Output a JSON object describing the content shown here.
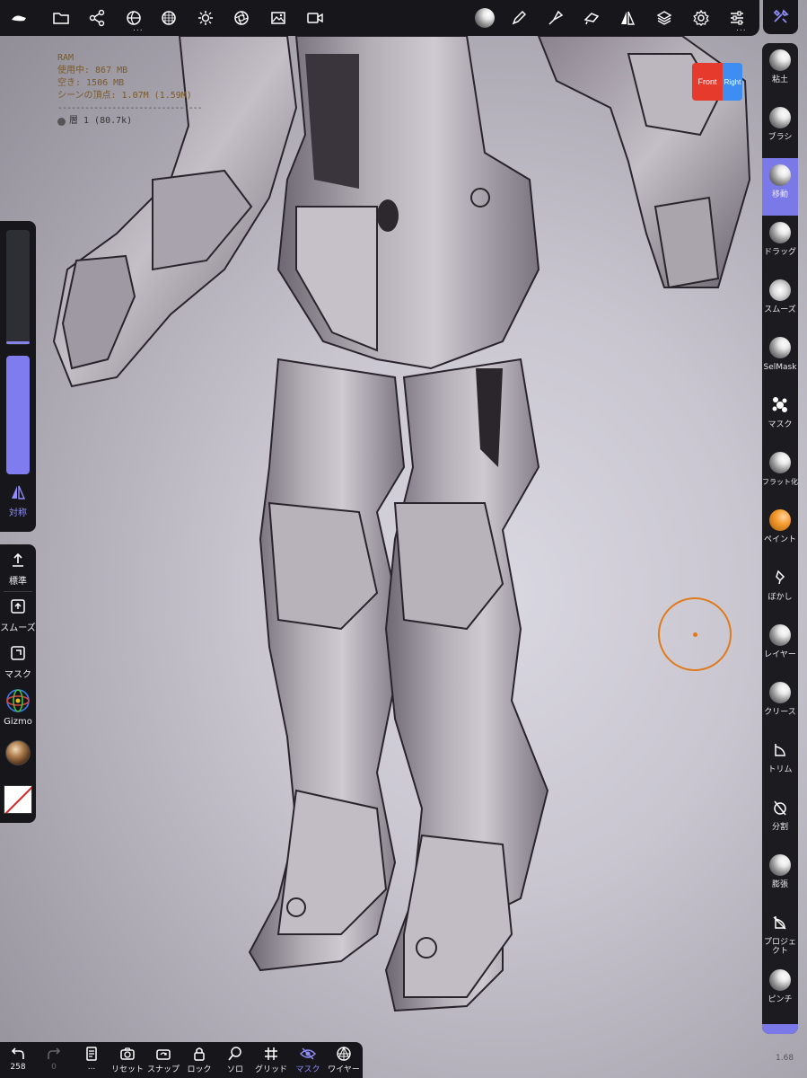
{
  "top_toolbar": {
    "items": [
      "menu-icon",
      "folder-icon",
      "scene-icon",
      "shading-icon",
      "grid-icon",
      "light-icon",
      "camera-icon",
      "image-icon",
      "video-icon",
      "matcap-icon",
      "pen-icon",
      "stroke-icon",
      "painting-icon",
      "symmetry-icon",
      "layers-icon",
      "settings-icon",
      "sliders-icon",
      "tools-icon"
    ],
    "more_indicator": "..."
  },
  "info": {
    "ram_label": "RAM",
    "used": "使用中: 867 MB",
    "free": "空き: 1506 MB",
    "vertices": "シーンの頂点: 1.07M (1.59M)",
    "separator": "--------------------------------",
    "layer": "層 1 (80.7k)"
  },
  "view_cube": {
    "front": "Front",
    "right": "Right"
  },
  "right_tools": [
    {
      "label": "粘土",
      "icon": "clay-icon",
      "active": false
    },
    {
      "label": "ブラシ",
      "icon": "brush-icon",
      "active": false
    },
    {
      "label": "移動",
      "icon": "move-icon",
      "active": true
    },
    {
      "label": "ドラッグ",
      "icon": "drag-icon",
      "active": false
    },
    {
      "label": "スムーズ",
      "icon": "smooth-icon",
      "active": false
    },
    {
      "label": "SelMask",
      "icon": "selmask-icon",
      "active": false
    },
    {
      "label": "マスク",
      "icon": "mask-icon",
      "active": false
    },
    {
      "label": "フラット化",
      "icon": "flatten-icon",
      "active": false
    },
    {
      "label": "ペイント",
      "icon": "paint-icon",
      "active": false
    },
    {
      "label": "ぼかし",
      "icon": "blur-icon",
      "active": false
    },
    {
      "label": "レイヤー",
      "icon": "layer-icon",
      "active": false
    },
    {
      "label": "クリース",
      "icon": "crease-icon",
      "active": false
    },
    {
      "label": "トリム",
      "icon": "trim-icon",
      "active": false
    },
    {
      "label": "分割",
      "icon": "split-icon",
      "active": false
    },
    {
      "label": "膨張",
      "icon": "inflate-icon",
      "active": false
    },
    {
      "label": "プロジェクト",
      "icon": "project-icon",
      "active": false
    },
    {
      "label": "ピンチ",
      "icon": "pinch-icon",
      "active": false
    }
  ],
  "left_panel": {
    "radius_level": 0.03,
    "intensity_level": 1.0,
    "symmetry_label": "対称",
    "stroke_modes": [
      {
        "label": "標準",
        "icon": "upload-icon"
      },
      {
        "label": "スムーズ",
        "icon": "smooth-box-icon"
      },
      {
        "label": "マスク",
        "icon": "mask-box-icon"
      },
      {
        "label": "Gizmo",
        "icon": "gizmo-icon"
      }
    ]
  },
  "bottom_bar": {
    "undo_count": "258",
    "redo_count": "0",
    "more_label": "...",
    "items": [
      {
        "label": "リセット",
        "icon": "reset-camera-icon"
      },
      {
        "label": "スナップ",
        "icon": "snap-icon"
      },
      {
        "label": "ロック",
        "icon": "lock-icon"
      },
      {
        "label": "ソロ",
        "icon": "solo-icon"
      },
      {
        "label": "グリッド",
        "icon": "grid-hash-icon"
      },
      {
        "label": "マスク",
        "icon": "mask-eye-icon",
        "active": true
      },
      {
        "label": "ワイヤー",
        "icon": "wire-icon"
      }
    ]
  },
  "zoom_label": "1.68",
  "colors": {
    "accent": "#7b78e8",
    "panel": "#17171b",
    "cursor": "#e07a1c"
  }
}
